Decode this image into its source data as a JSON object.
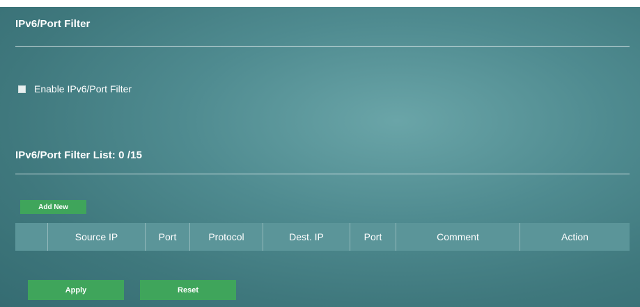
{
  "panel": {
    "section_title": "IPv6/Port Filter",
    "enable_label": "Enable IPv6/Port Filter",
    "enable_checked": false,
    "list_title": "IPv6/Port Filter List: 0 /15",
    "add_new_label": "Add New"
  },
  "table": {
    "columns": [
      "",
      "Source IP",
      "Port",
      "Protocol",
      "Dest. IP",
      "Port",
      "Comment",
      "Action"
    ]
  },
  "footer": {
    "apply_label": "Apply",
    "reset_label": "Reset"
  },
  "colors": {
    "panel_bg": "#4f8b90",
    "button_green": "#3fa55b",
    "header_row": "#5b9599"
  }
}
